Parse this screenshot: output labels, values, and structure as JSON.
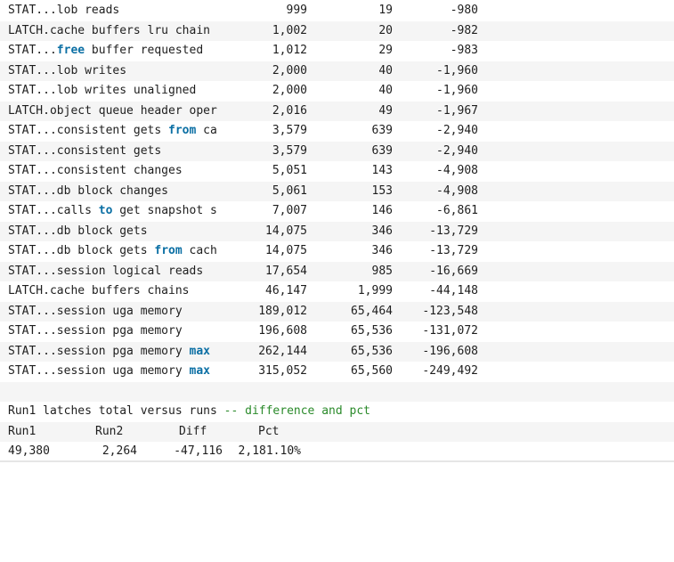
{
  "rows": [
    {
      "name": [
        {
          "t": "STAT...lob reads"
        }
      ],
      "run1": "999",
      "run2": "19",
      "diff": "-980"
    },
    {
      "name": [
        {
          "t": "LATCH.cache buffers lru chain"
        }
      ],
      "run1": "1,002",
      "run2": "20",
      "diff": "-982"
    },
    {
      "name": [
        {
          "t": "STAT..."
        },
        {
          "t": "free",
          "kw": true
        },
        {
          "t": " buffer requested"
        }
      ],
      "run1": "1,012",
      "run2": "29",
      "diff": "-983"
    },
    {
      "name": [
        {
          "t": "STAT...lob writes"
        }
      ],
      "run1": "2,000",
      "run2": "40",
      "diff": "-1,960"
    },
    {
      "name": [
        {
          "t": "STAT...lob writes unaligned"
        }
      ],
      "run1": "2,000",
      "run2": "40",
      "diff": "-1,960"
    },
    {
      "name": [
        {
          "t": "LATCH.object queue header oper"
        }
      ],
      "run1": "2,016",
      "run2": "49",
      "diff": "-1,967"
    },
    {
      "name": [
        {
          "t": "STAT...consistent gets "
        },
        {
          "t": "from",
          "kw": true
        },
        {
          "t": " ca"
        }
      ],
      "run1": "3,579",
      "run2": "639",
      "diff": "-2,940"
    },
    {
      "name": [
        {
          "t": "STAT...consistent gets"
        }
      ],
      "run1": "3,579",
      "run2": "639",
      "diff": "-2,940"
    },
    {
      "name": [
        {
          "t": "STAT...consistent changes"
        }
      ],
      "run1": "5,051",
      "run2": "143",
      "diff": "-4,908"
    },
    {
      "name": [
        {
          "t": "STAT...db block changes"
        }
      ],
      "run1": "5,061",
      "run2": "153",
      "diff": "-4,908"
    },
    {
      "name": [
        {
          "t": "STAT...calls "
        },
        {
          "t": "to",
          "kw": true
        },
        {
          "t": " get snapshot s"
        }
      ],
      "run1": "7,007",
      "run2": "146",
      "diff": "-6,861"
    },
    {
      "name": [
        {
          "t": "STAT...db block gets"
        }
      ],
      "run1": "14,075",
      "run2": "346",
      "diff": "-13,729"
    },
    {
      "name": [
        {
          "t": "STAT...db block gets "
        },
        {
          "t": "from",
          "kw": true
        },
        {
          "t": " cach"
        }
      ],
      "run1": "14,075",
      "run2": "346",
      "diff": "-13,729"
    },
    {
      "name": [
        {
          "t": "STAT...session logical reads"
        }
      ],
      "run1": "17,654",
      "run2": "985",
      "diff": "-16,669"
    },
    {
      "name": [
        {
          "t": "LATCH.cache buffers chains"
        }
      ],
      "run1": "46,147",
      "run2": "1,999",
      "diff": "-44,148"
    },
    {
      "name": [
        {
          "t": "STAT...session uga memory"
        }
      ],
      "run1": "189,012",
      "run2": "65,464",
      "diff": "-123,548"
    },
    {
      "name": [
        {
          "t": "STAT...session pga memory"
        }
      ],
      "run1": "196,608",
      "run2": "65,536",
      "diff": "-131,072"
    },
    {
      "name": [
        {
          "t": "STAT...session pga memory "
        },
        {
          "t": "max",
          "kw": true
        }
      ],
      "run1": "262,144",
      "run2": "65,536",
      "diff": "-196,608"
    },
    {
      "name": [
        {
          "t": "STAT...session uga memory "
        },
        {
          "t": "max",
          "kw": true
        }
      ],
      "run1": "315,052",
      "run2": "65,560",
      "diff": "-249,492"
    }
  ],
  "summary": {
    "heading": "Run1 latches total versus runs ",
    "comment": "-- difference and pct",
    "headers": [
      "Run1",
      "Run2",
      "Diff",
      "Pct"
    ],
    "values": [
      "49,380",
      "2,264",
      "-47,116",
      "2,181.10%"
    ]
  },
  "colors": {
    "keyword": "#0b6fa4",
    "comment": "#2a8a2a",
    "alt_row": "#f5f5f5"
  }
}
